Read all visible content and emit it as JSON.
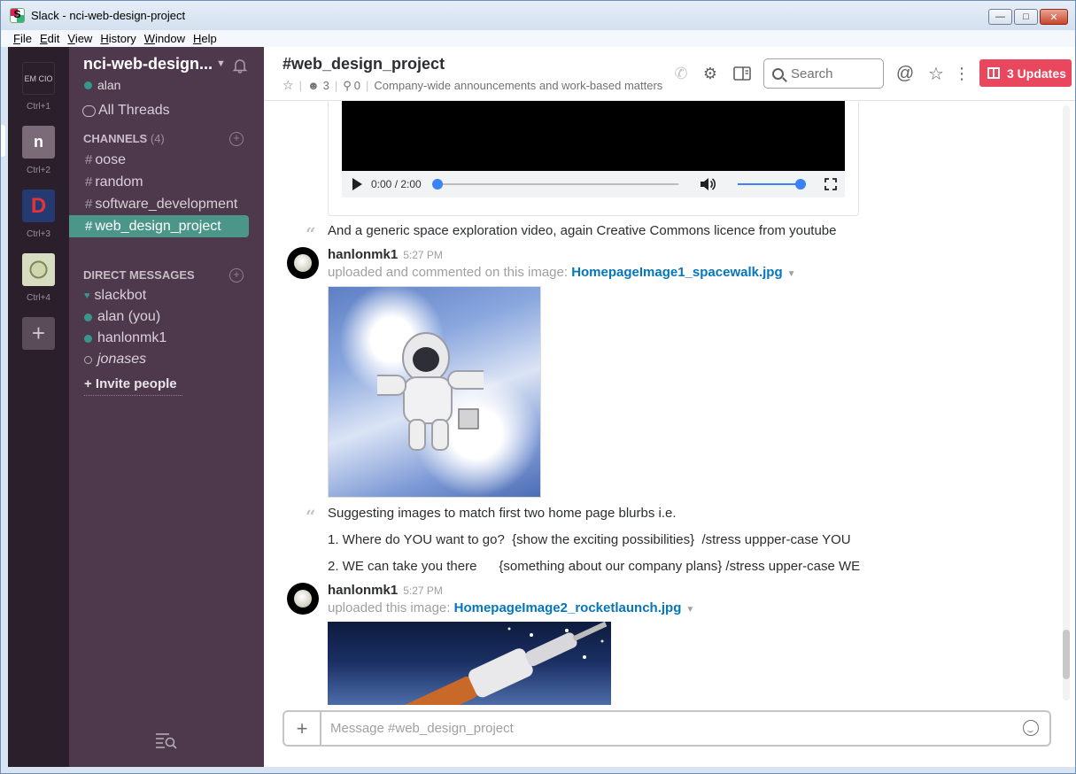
{
  "window": {
    "title": "Slack - nci-web-design-project",
    "app_icon_letter": "S"
  },
  "menu": {
    "items": [
      {
        "accel": "F",
        "rest": "ile"
      },
      {
        "accel": "E",
        "rest": "dit"
      },
      {
        "accel": "V",
        "rest": "iew"
      },
      {
        "accel": "H",
        "rest": "istory"
      },
      {
        "accel": "W",
        "rest": "indow"
      },
      {
        "accel": "H",
        "rest": "elp"
      }
    ]
  },
  "teams": [
    {
      "label": "EM CIO",
      "shortcut": "Ctrl+1",
      "color": "#2a1f2a"
    },
    {
      "label": "n",
      "shortcut": "Ctrl+2",
      "color": "#7b6b79"
    },
    {
      "label": "D",
      "shortcut": "Ctrl+3",
      "color": "#243a70"
    },
    {
      "label": "",
      "shortcut": "Ctrl+4",
      "color": "#7f8a5c"
    }
  ],
  "sidebar": {
    "workspace": "nci-web-design...",
    "user": "alan",
    "all_threads": "All Threads",
    "channels_header": "CHANNELS",
    "channels_count": "(4)",
    "channels": [
      "oose",
      "random",
      "software_development",
      "web_design_project"
    ],
    "dm_header": "DIRECT MESSAGES",
    "dms": [
      "slackbot",
      "alan (you)",
      "hanlonmk1",
      "jonases"
    ],
    "invite": "+ Invite people"
  },
  "header": {
    "channel": "#web_design_project",
    "members": "3",
    "pins": "0",
    "topic": "Company-wide announcements and work-based matters",
    "search_placeholder": "Search",
    "updates": "3 Updates"
  },
  "video": {
    "time": "0:00 / 2:00"
  },
  "messages": {
    "m1": "And a generic space exploration video, again Creative Commons licence from youtube",
    "u1_name": "hanlonmk1",
    "u1_time": "5:27 PM",
    "u1_action": "uploaded and commented on this image: ",
    "u1_file": "HomepageImage1_spacewalk.jpg",
    "m2": "Suggesting images to match first two home page blurbs i.e.",
    "m3": "1. Where do YOU want to go?  {show the exciting possibilities}  /stress uppper-case YOU",
    "m4": "2. WE can take you there      {something about our company plans} /stress upper-case WE",
    "u2_name": "hanlonmk1",
    "u2_time": "5:27 PM",
    "u2_action": "uploaded this image: ",
    "u2_file": "HomepageImage2_rocketlaunch.jpg"
  },
  "composer": {
    "placeholder": "Message #web_design_project"
  }
}
